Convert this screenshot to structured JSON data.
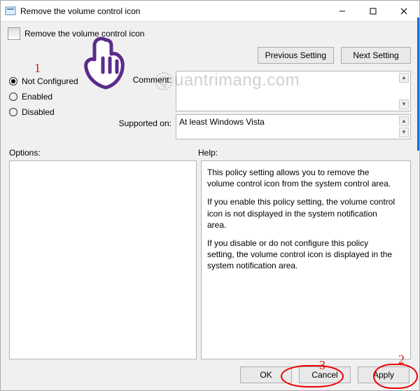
{
  "window": {
    "title": "Remove the volume control icon",
    "header_title": "Remove the volume control icon"
  },
  "nav": {
    "previous": "Previous Setting",
    "next": "Next Setting"
  },
  "state": {
    "selected": "not_configured",
    "options": {
      "not_configured": "Not Configured",
      "enabled": "Enabled",
      "disabled": "Disabled"
    },
    "comment_label": "Comment:",
    "comment_value": "",
    "supported_label": "Supported on:",
    "supported_value": "At least Windows Vista"
  },
  "section_labels": {
    "options": "Options:",
    "help": "Help:"
  },
  "help": {
    "p1": "This policy setting allows you to remove the volume control icon from the system control area.",
    "p2": "If you enable this policy setting, the volume control icon is not displayed in the system notification area.",
    "p3": "If you disable or do not configure this policy setting, the volume control icon is displayed in the system notification area."
  },
  "footer": {
    "ok": "OK",
    "cancel": "Cancel",
    "apply": "Apply"
  },
  "annotations": {
    "n1": "1",
    "n2": "2",
    "n3": "3"
  },
  "watermark": {
    "text": "uantrimang.com",
    "q": "Q"
  }
}
